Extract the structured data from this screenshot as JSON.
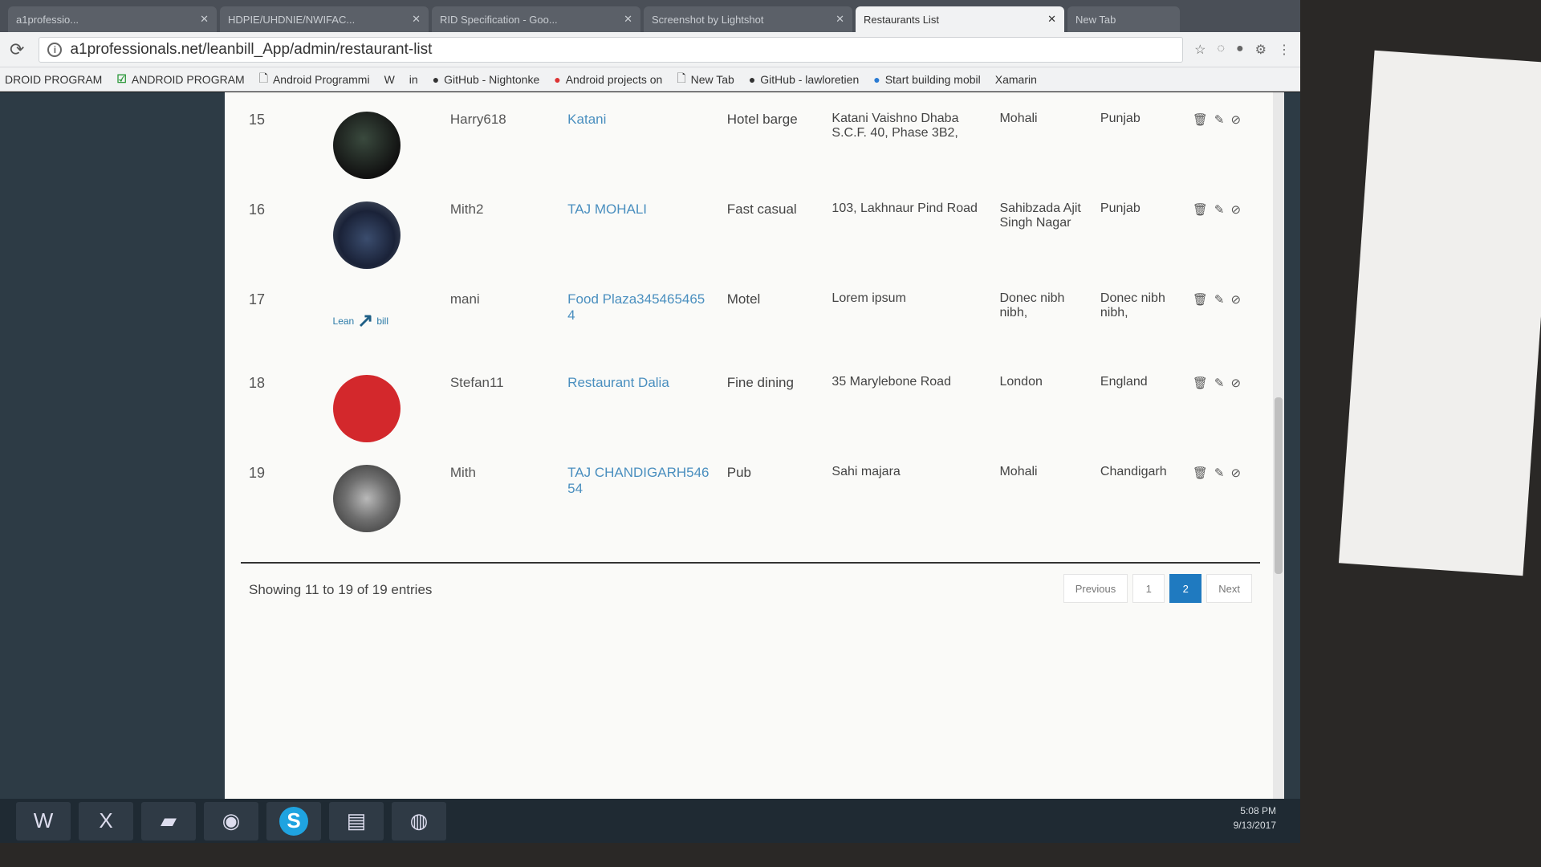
{
  "browser": {
    "tabs": [
      {
        "label": "a1professio...",
        "active": false
      },
      {
        "label": "HDPIE/UHDNIE/NWIFAC...",
        "active": false
      },
      {
        "label": "RID Specification - Goo...",
        "active": false
      },
      {
        "label": "Screenshot by Lightshot",
        "active": false
      },
      {
        "label": "Restaurants List",
        "active": true
      },
      {
        "label": "New Tab",
        "active": false
      }
    ],
    "url": "a1professionals.net/leanbill_App/admin/restaurant-list",
    "bookmarks": [
      {
        "label": "DROID PROGRAM",
        "icon": "page-icon"
      },
      {
        "label": "ANDROID PROGRAM",
        "icon": "green-check-icon"
      },
      {
        "label": "Android Programmi",
        "icon": "page-icon"
      },
      {
        "label": "W",
        "icon": "wikipedia-icon"
      },
      {
        "label": "in",
        "icon": "linkedin-icon"
      },
      {
        "label": "GitHub - Nightonke",
        "icon": "github-icon"
      },
      {
        "label": "Android projects on",
        "icon": "red-circle-icon"
      },
      {
        "label": "New Tab",
        "icon": "page-icon"
      },
      {
        "label": "GitHub - lawloretien",
        "icon": "github-icon"
      },
      {
        "label": "Start building mobil",
        "icon": "blue-circle-icon"
      },
      {
        "label": "Xamarin",
        "icon": "page-icon"
      }
    ]
  },
  "table": {
    "rows": [
      {
        "no": "15",
        "avatar": "dark",
        "user": "Harry618",
        "name": "Katani",
        "type": "Hotel barge",
        "address": "Katani Vaishno Dhaba S.C.F. 40, Phase 3B2,",
        "city": "Mohali",
        "state": "Punjab"
      },
      {
        "no": "16",
        "avatar": "blue",
        "user": "Mith2",
        "name": "TAJ MOHALI",
        "type": "Fast casual",
        "address": "103, Lakhnaur Pind Road",
        "city": "Sahibzada Ajit Singh Nagar",
        "state": "Punjab"
      },
      {
        "no": "17",
        "avatar": "logo",
        "user": "mani",
        "name": "Food Plaza3454654654",
        "type": "Motel",
        "address": "Lorem ipsum",
        "city": "Donec nibh nibh,",
        "state": "Donec nibh nibh,"
      },
      {
        "no": "18",
        "avatar": "red",
        "user": "Stefan11",
        "name": "Restaurant Dalia",
        "type": "Fine dining",
        "address": "35 Marylebone Road",
        "city": "London",
        "state": "England"
      },
      {
        "no": "19",
        "avatar": "koala",
        "user": "Mith",
        "name": "TAJ CHANDIGARH54654",
        "type": "Pub",
        "address": "Sahi majara",
        "city": "Mohali",
        "state": "Chandigarh"
      }
    ],
    "logo_text_left": "Lean",
    "logo_text_right": "bill"
  },
  "footer": {
    "info": "Showing 11 to 19 of 19 entries",
    "previous": "Previous",
    "page1": "1",
    "page2": "2",
    "next": "Next"
  },
  "taskbar": {
    "time": "5:08 PM",
    "date": "9/13/2017",
    "apps": [
      "word",
      "excel",
      "folder",
      "chrome",
      "skype",
      "explorer",
      "android-studio"
    ]
  }
}
